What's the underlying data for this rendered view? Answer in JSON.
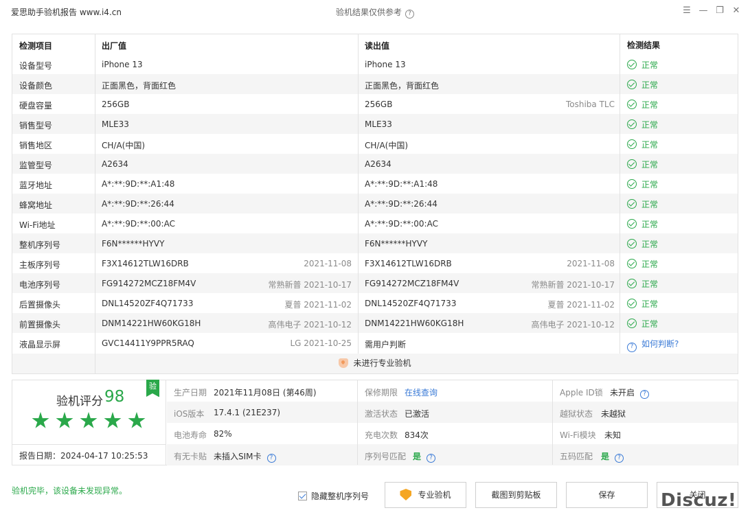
{
  "window": {
    "app_title": "爱思助手验机报告 www.i4.cn",
    "center_title": "验机结果仅供参考",
    "help_glyph": "?"
  },
  "table": {
    "headers": [
      "检测项目",
      "出厂值",
      "读出值",
      "检测结果"
    ],
    "rows": [
      {
        "item": "设备型号",
        "factory": "iPhone 13",
        "factory_note": "",
        "read": "iPhone 13",
        "read_note": "",
        "result": "正常",
        "status": "ok"
      },
      {
        "item": "设备颜色",
        "factory": "正面黑色，背面红色",
        "factory_note": "",
        "read": "正面黑色，背面红色",
        "read_note": "",
        "result": "正常",
        "status": "ok"
      },
      {
        "item": "硬盘容量",
        "factory": "256GB",
        "factory_note": "",
        "read": "256GB",
        "read_note": "Toshiba TLC",
        "result": "正常",
        "status": "ok"
      },
      {
        "item": "销售型号",
        "factory": "MLE33",
        "factory_note": "",
        "read": "MLE33",
        "read_note": "",
        "result": "正常",
        "status": "ok"
      },
      {
        "item": "销售地区",
        "factory": "CH/A(中国)",
        "factory_note": "",
        "read": "CH/A(中国)",
        "read_note": "",
        "result": "正常",
        "status": "ok"
      },
      {
        "item": "监管型号",
        "factory": "A2634",
        "factory_note": "",
        "read": "A2634",
        "read_note": "",
        "result": "正常",
        "status": "ok"
      },
      {
        "item": "蓝牙地址",
        "factory": "A*:**:9D:**:A1:48",
        "factory_note": "",
        "read": "A*:**:9D:**:A1:48",
        "read_note": "",
        "result": "正常",
        "status": "ok"
      },
      {
        "item": "蜂窝地址",
        "factory": "A*:**:9D:**:26:44",
        "factory_note": "",
        "read": "A*:**:9D:**:26:44",
        "read_note": "",
        "result": "正常",
        "status": "ok"
      },
      {
        "item": "Wi-Fi地址",
        "factory": "A*:**:9D:**:00:AC",
        "factory_note": "",
        "read": "A*:**:9D:**:00:AC",
        "read_note": "",
        "result": "正常",
        "status": "ok"
      },
      {
        "item": "整机序列号",
        "factory": "F6N******HYVY",
        "factory_note": "",
        "read": "F6N******HYVY",
        "read_note": "",
        "result": "正常",
        "status": "ok"
      },
      {
        "item": "主板序列号",
        "factory": "F3X14612TLW16DRB",
        "factory_note": "2021-11-08",
        "read": "F3X14612TLW16DRB",
        "read_note": "2021-11-08",
        "result": "正常",
        "status": "ok"
      },
      {
        "item": "电池序列号",
        "factory": "FG914272MCZ18FM4V",
        "factory_note": "常熟新普 2021-10-17",
        "read": "FG914272MCZ18FM4V",
        "read_note": "常熟新普 2021-10-17",
        "result": "正常",
        "status": "ok"
      },
      {
        "item": "后置摄像头",
        "factory": "DNL14520ZF4Q71733",
        "factory_note": "夏普 2021-11-02",
        "read": "DNL14520ZF4Q71733",
        "read_note": "夏普 2021-11-02",
        "result": "正常",
        "status": "ok"
      },
      {
        "item": "前置摄像头",
        "factory": "DNM14221HW60KG18H",
        "factory_note": "高伟电子 2021-10-12",
        "read": "DNM14221HW60KG18H",
        "read_note": "高伟电子 2021-10-12",
        "result": "正常",
        "status": "ok"
      },
      {
        "item": "液晶显示屏",
        "factory": "GVC14411Y9PPR5RAQ",
        "factory_note": "LG 2021-10-25",
        "read": "需用户判断",
        "read_note": "",
        "result": "如何判断?",
        "status": "ask"
      }
    ],
    "footer_note": "未进行专业验机"
  },
  "summary": {
    "score_label": "验机评分",
    "score_value": "98",
    "badge": "验",
    "stars": 5,
    "report_date": "报告日期：2024-04-17 10:25:53",
    "rows": [
      [
        {
          "key": "生产日期",
          "value": "2021年11月08日 (第46周)",
          "style": "plain",
          "help": false
        },
        {
          "key": "保修期限",
          "value": "在线查询",
          "style": "link",
          "help": false
        },
        {
          "key": "Apple ID锁",
          "value": "未开启",
          "style": "plain",
          "help": true
        }
      ],
      [
        {
          "key": "iOS版本",
          "value": "17.4.1 (21E237)",
          "style": "plain",
          "help": false
        },
        {
          "key": "激活状态",
          "value": "已激活",
          "style": "plain",
          "help": false
        },
        {
          "key": "越狱状态",
          "value": "未越狱",
          "style": "plain",
          "help": false
        }
      ],
      [
        {
          "key": "电池寿命",
          "value": "82%",
          "style": "plain",
          "help": false
        },
        {
          "key": "充电次数",
          "value": "834次",
          "style": "plain",
          "help": false
        },
        {
          "key": "Wi-Fi模块",
          "value": "未知",
          "style": "plain",
          "help": false
        }
      ],
      [
        {
          "key": "有无卡贴",
          "value": "未插入SIM卡",
          "style": "plain",
          "help": true
        },
        {
          "key": "序列号匹配",
          "value": "是",
          "style": "green",
          "help": true
        },
        {
          "key": "五码匹配",
          "value": "是",
          "style": "green",
          "help": true
        }
      ]
    ]
  },
  "bottom": {
    "status": "验机完毕，该设备未发现异常。",
    "hide_serial_label": "隐藏整机序列号",
    "hide_serial_checked": true,
    "btn_pro": "专业验机",
    "btn_screenshot": "截图到剪贴板",
    "btn_save": "保存",
    "btn_close": "关闭",
    "watermark": "Discuz!"
  }
}
